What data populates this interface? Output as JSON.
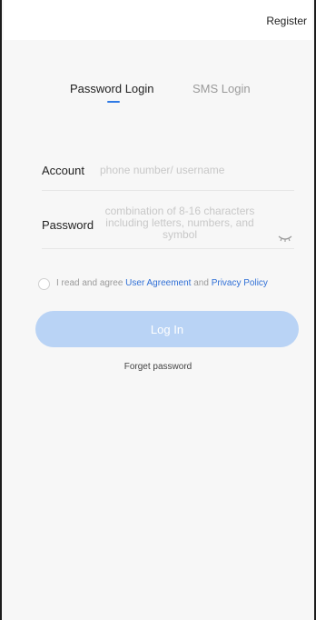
{
  "header": {
    "register_label": "Register"
  },
  "tabs": [
    {
      "label": "Password Login",
      "active": true
    },
    {
      "label": "SMS Login",
      "active": false
    }
  ],
  "form": {
    "account": {
      "label": "Account",
      "placeholder": "phone number/ username",
      "value": ""
    },
    "password": {
      "label": "Password",
      "placeholder": "combination of 8-16 characters including letters, numbers, and symbol",
      "value": ""
    }
  },
  "agreement": {
    "checked": false,
    "prefix": "I read and agree",
    "user_agreement": "User Agreement",
    "and": "and",
    "privacy_policy": "Privacy Policy"
  },
  "login_button": {
    "label": "Log In",
    "color": "#b9d3f5"
  },
  "forget_label": "Forget password",
  "colors": {
    "accent": "#2f7ae5",
    "link": "#2f6fd6",
    "background": "#f7f7f7"
  },
  "icons": {
    "password_toggle": "eye-closed-icon"
  }
}
